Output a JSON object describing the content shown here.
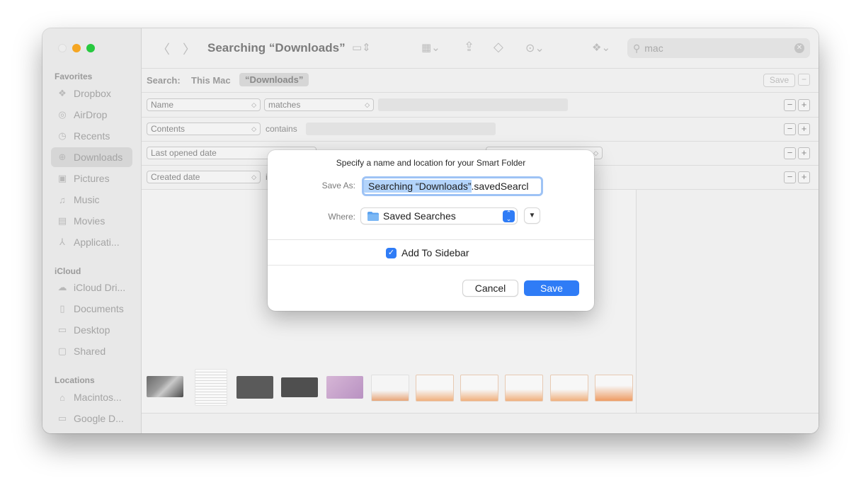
{
  "toolbar": {
    "title": "Searching “Downloads”",
    "search_value": "mac"
  },
  "sidebar": {
    "favorites_title": "Favorites",
    "favorites": [
      {
        "label": "Dropbox",
        "icon": "dropbox-icon"
      },
      {
        "label": "AirDrop",
        "icon": "airdrop-icon"
      },
      {
        "label": "Recents",
        "icon": "clock-icon"
      },
      {
        "label": "Downloads",
        "icon": "download-icon"
      },
      {
        "label": "Pictures",
        "icon": "pictures-icon"
      },
      {
        "label": "Music",
        "icon": "music-icon"
      },
      {
        "label": "Movies",
        "icon": "movies-icon"
      },
      {
        "label": "Applicati...",
        "icon": "applications-icon"
      }
    ],
    "icloud_title": "iCloud",
    "icloud": [
      {
        "label": "iCloud Dri...",
        "icon": "cloud-icon"
      },
      {
        "label": "Documents",
        "icon": "document-icon"
      },
      {
        "label": "Desktop",
        "icon": "desktop-icon"
      },
      {
        "label": "Shared",
        "icon": "shared-folder-icon"
      }
    ],
    "locations_title": "Locations",
    "locations": [
      {
        "label": "Macintos...",
        "icon": "disk-icon"
      },
      {
        "label": "Google D...",
        "icon": "folder-icon"
      }
    ]
  },
  "scope": {
    "label": "Search:",
    "this_mac": "This Mac",
    "downloads": "“Downloads”",
    "save": "Save"
  },
  "criteria": [
    {
      "attribute": "Name",
      "operator": "matches"
    },
    {
      "attribute": "Contents",
      "operator": "contains"
    },
    {
      "attribute": "Last opened date"
    },
    {
      "attribute": "Created date",
      "operator": "i"
    }
  ],
  "dialog": {
    "title": "Specify a name and location for your Smart Folder",
    "save_as_label": "Save As:",
    "save_as_selected": "Searching “Downloads”",
    "save_as_rest": ".savedSearcl",
    "where_label": "Where:",
    "where_value": "Saved Searches",
    "add_to_sidebar": "Add To Sidebar",
    "add_to_sidebar_checked": true,
    "cancel": "Cancel",
    "save": "Save"
  },
  "colors": {
    "accent": "#2f7cf6",
    "close": "#ededed",
    "minimize": "#f5a623",
    "zoom": "#27c93f"
  }
}
